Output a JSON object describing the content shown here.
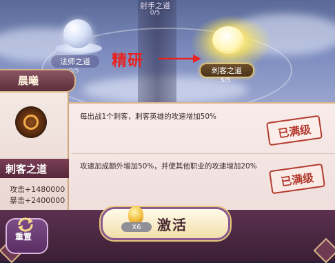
{
  "paths": {
    "top": {
      "title": "射手之道",
      "count": "0/5"
    },
    "left": {
      "title": "法师之道",
      "count": "0/5"
    },
    "right": {
      "title": "刺客之道",
      "count": "5/5"
    }
  },
  "annotation": {
    "text": "精研",
    "color": "#e8231f"
  },
  "hero": {
    "name": "晨曦",
    "class_name": "刺客之道",
    "attack": "攻击+1480000",
    "armor_break": "暴击+2400000"
  },
  "effects": [
    {
      "text": "每出战1个刺客，刺客英雄的攻速增加50%",
      "status": "已满级"
    },
    {
      "text": "攻速加成额外增加50%，并使其他职业的攻速增加20%",
      "status": "已满级"
    }
  ],
  "activate": {
    "label": "激活",
    "cost": "X6"
  },
  "reset": {
    "label": "重置"
  },
  "colors": {
    "stamp": "#b33a2e",
    "glow": "#ffe66a"
  }
}
